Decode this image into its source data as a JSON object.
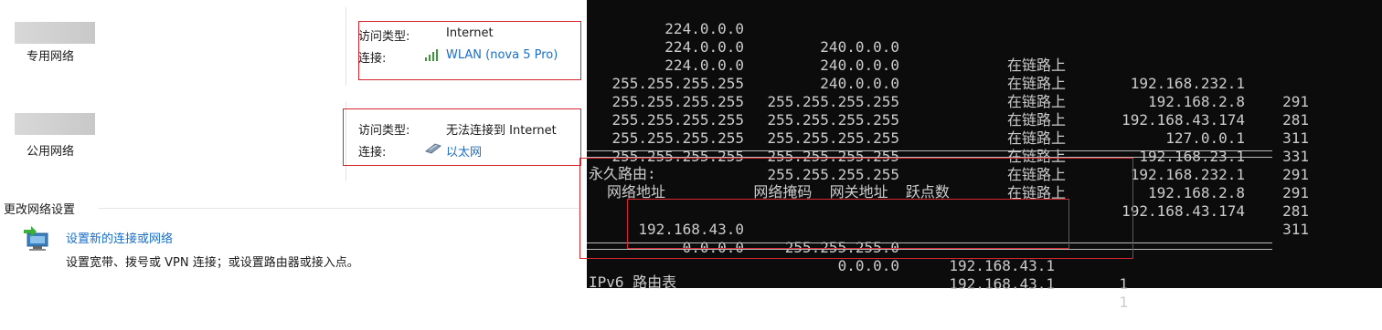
{
  "networks": [
    {
      "name": "专用网络",
      "access_type_label": "访问类型:",
      "access_type": "Internet",
      "connection_label": "连接:",
      "connection": "WLAN (nova 5 Pro)",
      "connection_icon": "wifi-signal-icon"
    },
    {
      "name": "公用网络",
      "access_type_label": "访问类型:",
      "access_type": "无法连接到 Internet",
      "connection_label": "连接:",
      "connection": "以太网",
      "connection_icon": "ethernet-icon"
    }
  ],
  "settings": {
    "title": "更改网络设置",
    "setup_link": "设置新的连接或网络",
    "setup_desc": "设置宽带、拨号或 VPN 连接；或设置路由器或接入点。"
  },
  "terminal": {
    "routes": [
      [
        "224.0.0.0",
        "240.0.0.0",
        "在链路上",
        "192.168.232.1",
        "291"
      ],
      [
        "224.0.0.0",
        "240.0.0.0",
        "在链路上",
        "192.168.2.8",
        "281"
      ],
      [
        "224.0.0.0",
        "240.0.0.0",
        "在链路上",
        "192.168.43.174",
        "311"
      ],
      [
        "255.255.255.255",
        "255.255.255.255",
        "在链路上",
        "127.0.0.1",
        "331"
      ],
      [
        "255.255.255.255",
        "255.255.255.255",
        "在链路上",
        "192.168.23.1",
        "291"
      ],
      [
        "255.255.255.255",
        "255.255.255.255",
        "在链路上",
        "192.168.232.1",
        "291"
      ],
      [
        "255.255.255.255",
        "255.255.255.255",
        "在链路上",
        "192.168.2.8",
        "281"
      ],
      [
        "255.255.255.255",
        "255.255.255.255",
        "在链路上",
        "192.168.43.174",
        "311"
      ]
    ],
    "persistent_title": "永久路由:",
    "persistent_headers": "网络地址          网络掩码  网关地址  跃点数",
    "persistent_routes": [
      [
        "192.168.43.0",
        "255.255.255.0",
        "192.168.43.1",
        "1"
      ],
      [
        "0.0.0.0",
        "0.0.0.0",
        "192.168.43.1",
        "1"
      ]
    ],
    "ipv6_title": "IPv6 路由表"
  }
}
